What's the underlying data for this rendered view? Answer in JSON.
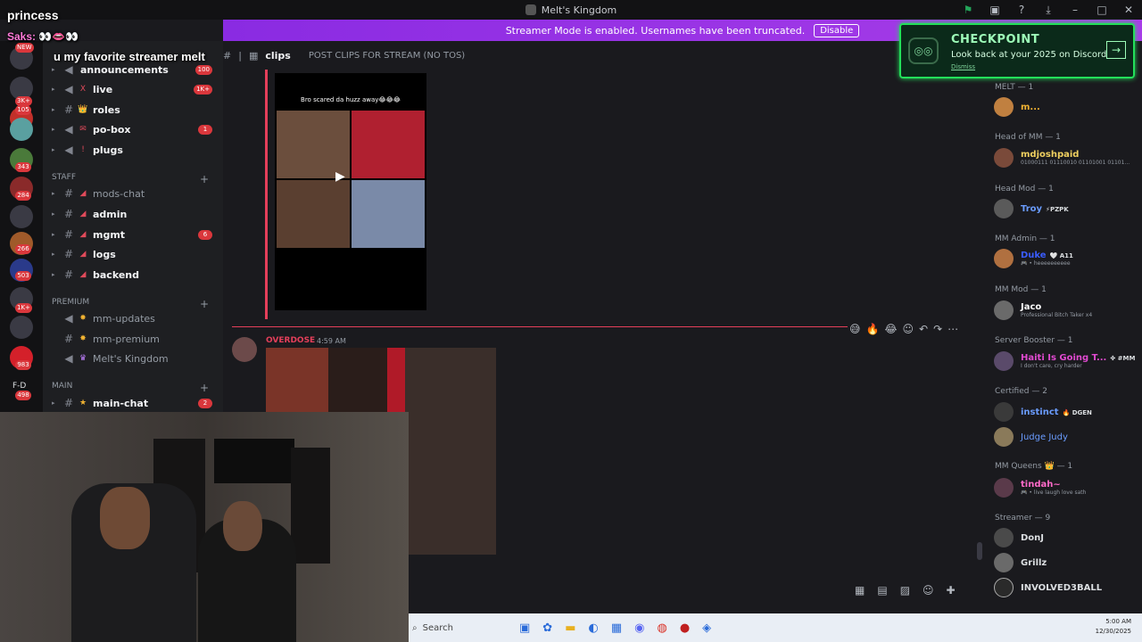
{
  "window": {
    "title": "Melt's Kingdom"
  },
  "overlay": {
    "line1": "princess",
    "line2": "Saks: 👀👄👀",
    "line3": "u my favorite streamer melt"
  },
  "banner": {
    "text": "Streamer Mode is enabled. Usernames have been truncated.",
    "button": "Disable"
  },
  "checkpoint": {
    "title": "CHECKPOINT",
    "subtitle": "Look back at your 2025 on Discord",
    "dismiss": "Dismiss"
  },
  "server_badges": [
    "NEW",
    "202",
    "3K+",
    "105",
    "",
    "343",
    "284",
    "",
    "266",
    "503",
    "1K+",
    "",
    "983",
    "498"
  ],
  "server_letters": "F-D",
  "channels": [
    {
      "name": "announcements",
      "icon": "speaker-icon",
      "emoji": "",
      "badge": "",
      "bold": true
    },
    {
      "name": "live",
      "icon": "speaker-icon",
      "emoji": "X",
      "badge": "1K+",
      "bold": true
    },
    {
      "name": "roles",
      "icon": "hash-icon",
      "emoji": "👑",
      "badge": "",
      "bold": true
    },
    {
      "name": "po-box",
      "icon": "speaker-icon",
      "emoji": "✉",
      "badge": "1",
      "bold": true
    },
    {
      "name": "plugs",
      "icon": "speaker-icon",
      "emoji": "!",
      "badge": "",
      "bold": true
    }
  ],
  "categories": {
    "staff": "STAFF",
    "premium": "PREMIUM",
    "main": "MAIN"
  },
  "staff_channels": [
    {
      "name": "mods-chat",
      "badge": "",
      "bold": false
    },
    {
      "name": "admin",
      "badge": "",
      "bold": true
    },
    {
      "name": "mgmt",
      "badge": "6",
      "bold": true
    },
    {
      "name": "logs",
      "badge": "",
      "bold": true
    },
    {
      "name": "backend",
      "badge": "",
      "bold": true
    }
  ],
  "premium_channels": [
    {
      "name": "mm-updates"
    },
    {
      "name": "mm-premium"
    },
    {
      "name": "Melt's Kingdom"
    }
  ],
  "main_channels": [
    {
      "name": "main-chat",
      "badge": "2"
    }
  ],
  "header": {
    "channel": "clips",
    "topic": "POST CLIPS FOR STREAM (NO TOS)"
  },
  "post1": {
    "caption": "Bro scared da huzz away😂😂😂"
  },
  "msg2": {
    "author": "OVERDOSE",
    "time": "4:59 AM"
  },
  "members": {
    "roles": [
      {
        "label": "MELT — 1"
      },
      {
        "label": "Head of MM — 1"
      },
      {
        "label": "Head Mod — 1"
      },
      {
        "label": "MM Admin — 1"
      },
      {
        "label": "MM Mod — 1"
      },
      {
        "label": "Server Booster — 1"
      },
      {
        "label": "Certified — 2"
      },
      {
        "label": "MM Queens 👑 — 1"
      },
      {
        "label": "Streamer — 9"
      }
    ],
    "list": [
      {
        "name": "m...",
        "status": "",
        "tag": "",
        "color": "#f0b232"
      },
      {
        "name": "mdjoshpaid",
        "status": "01000111 01110010 01101001 01101...",
        "tag": "",
        "color": "#f0d060"
      },
      {
        "name": "Troy",
        "status": "",
        "tag": "⚡PZPK",
        "color": "#6a9cff"
      },
      {
        "name": "Duke",
        "status": "🎮 • heeeeeeeeee",
        "tag": "🤍 A11",
        "color": "#3a5cff"
      },
      {
        "name": "Jaco",
        "status": "Professional Bitch Taker x4",
        "tag": "",
        "color": "#ffffff"
      },
      {
        "name": "Haiti Is Going T...",
        "status": "I don't care, cry harder",
        "tag": "✤ #MM",
        "color": "#e04ad0"
      },
      {
        "name": "instinct",
        "status": "",
        "tag": "🔥 DGEN",
        "color": "#6a9cff"
      },
      {
        "name": "Judge Judy",
        "status": "",
        "tag": "",
        "color": "#6a9cff"
      },
      {
        "name": "tindah~",
        "status": "🎮 • live laugh love sath",
        "tag": "",
        "color": "#ff6ac8"
      },
      {
        "name": "DonJ",
        "status": "",
        "tag": "",
        "color": "#f0f0f0"
      },
      {
        "name": "Grillz",
        "status": "",
        "tag": "",
        "color": "#f0f0f0"
      },
      {
        "name": "INVOLVED3BALL",
        "status": "",
        "tag": "",
        "color": "#f0f0f0"
      }
    ]
  },
  "taskbar": {
    "search_placeholder": "Search",
    "time": "5:00 AM",
    "date": "12/30/2025"
  },
  "colors": {
    "accent_red": "#e43f5a",
    "banner": "#8a2be2",
    "checkpoint_green": "#23e05a"
  }
}
